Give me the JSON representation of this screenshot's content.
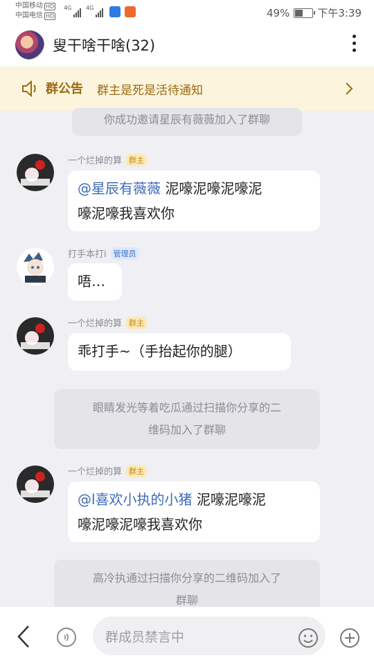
{
  "status_bar": {
    "carrier1": "中国移动",
    "carrier2": "中国电信",
    "hd": "HD",
    "network_label": "4G",
    "battery_percent": "49%",
    "battery_level": 0.49,
    "time": "下午3:39"
  },
  "header": {
    "title": "叟干啥干啥(32)"
  },
  "announcement": {
    "title": "群公告",
    "text": "群主是死是活待通知"
  },
  "messages": [
    {
      "type": "system",
      "text": "你成功邀请星辰有薇薇加入了群聊"
    },
    {
      "type": "chat",
      "nickname": "一个烂掉的算",
      "tag": "群主",
      "mention": "@星辰有薇薇",
      "line1_rest": " 泥嚎泥嚎泥嚎泥",
      "line2": "嚎泥嚎我喜欢你"
    },
    {
      "type": "chat",
      "nickname": "打手本打i",
      "tag": "管理员",
      "text": "唔…"
    },
    {
      "type": "chat",
      "nickname": "一个烂掉的算",
      "tag": "群主",
      "text": "乖打手~（手抬起你的腿）"
    },
    {
      "type": "system",
      "line1": "眼睛发光等着吃瓜通过扫描你分享的二",
      "line2": "维码加入了群聊"
    },
    {
      "type": "chat",
      "nickname": "一个烂掉的算",
      "tag": "群主",
      "mention": "@l喜欢小执的小猪",
      "line1_rest": " 泥嚎泥嚎泥",
      "line2": "嚎泥嚎泥嚎我喜欢你"
    },
    {
      "type": "system",
      "line1": "高冷执通过扫描你分享的二维码加入了",
      "line2": "群聊"
    }
  ],
  "input": {
    "placeholder": "群成员禁言中"
  },
  "colors": {
    "accent_link": "#3d6bb8",
    "notice_bg": "#fcf4dc",
    "notice_text": "#9b6a12",
    "owner_tag": "#fbe9b7",
    "admin_tag": "#dde8fb"
  }
}
